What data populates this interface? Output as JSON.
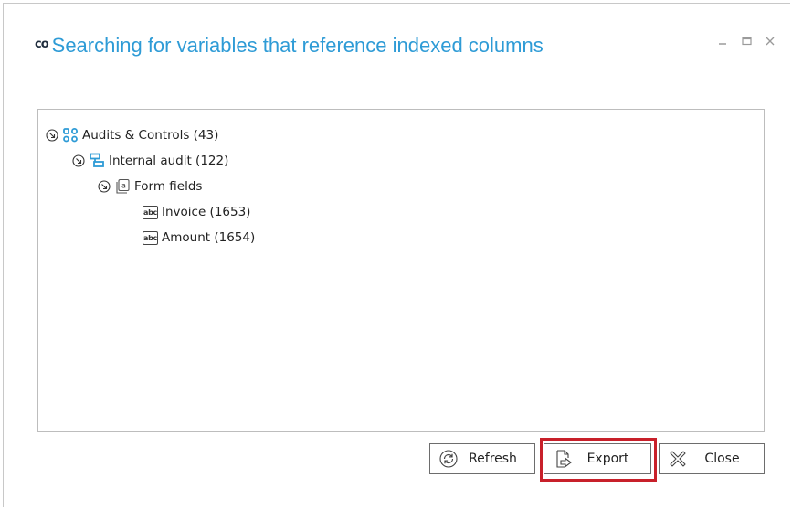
{
  "window": {
    "logo": "co",
    "title": "Searching for variables that reference indexed columns",
    "controls": {
      "minimize": "minimize-icon",
      "maximize": "maximize-icon",
      "close": "close-icon"
    }
  },
  "tree": {
    "nodes": [
      {
        "label": "Audits & Controls (43)",
        "icon": "process-group-icon",
        "expanded": true
      },
      {
        "label": "Internal audit (122)",
        "icon": "workflow-icon",
        "expanded": true
      },
      {
        "label": "Form fields",
        "icon": "form-fields-icon",
        "expanded": true
      },
      {
        "label": "Invoice (1653)",
        "icon": "text-field-icon",
        "icon_text": "abc"
      },
      {
        "label": "Amount (1654)",
        "icon": "text-field-icon",
        "icon_text": "abc"
      }
    ]
  },
  "buttons": {
    "refresh": {
      "label": "Refresh",
      "icon": "refresh-icon"
    },
    "export": {
      "label": "Export",
      "icon": "export-icon",
      "highlighted": true
    },
    "close": {
      "label": "Close",
      "icon": "close-x-icon"
    }
  },
  "colors": {
    "title": "#2e9bd6",
    "icon_blue": "#2e9bd6",
    "highlight": "#c8202a"
  }
}
